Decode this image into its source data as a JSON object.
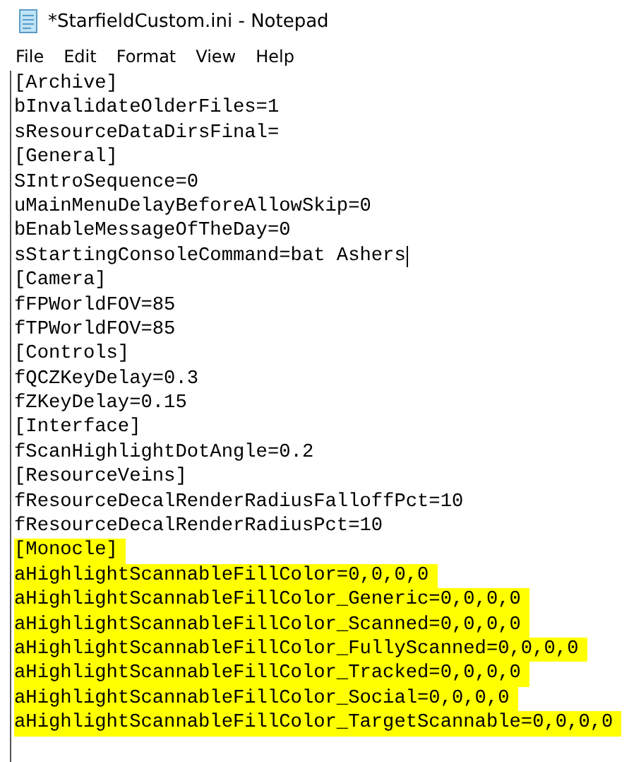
{
  "window": {
    "title": "*StarfieldCustom.ini - Notepad"
  },
  "menu": [
    "File",
    "Edit",
    "Format",
    "View",
    "Help"
  ],
  "lines": [
    {
      "text": "[Archive]",
      "highlighted": false,
      "cursor": false
    },
    {
      "text": "bInvalidateOlderFiles=1",
      "highlighted": false,
      "cursor": false
    },
    {
      "text": "sResourceDataDirsFinal=",
      "highlighted": false,
      "cursor": false
    },
    {
      "text": "[General]",
      "highlighted": false,
      "cursor": false
    },
    {
      "text": "SIntroSequence=0",
      "highlighted": false,
      "cursor": false
    },
    {
      "text": "uMainMenuDelayBeforeAllowSkip=0",
      "highlighted": false,
      "cursor": false
    },
    {
      "text": "bEnableMessageOfTheDay=0",
      "highlighted": false,
      "cursor": false
    },
    {
      "text": "sStartingConsoleCommand=bat Ashers",
      "highlighted": false,
      "cursor": true
    },
    {
      "text": "[Camera]",
      "highlighted": false,
      "cursor": false
    },
    {
      "text": "fFPWorldFOV=85",
      "highlighted": false,
      "cursor": false
    },
    {
      "text": "fTPWorldFOV=85",
      "highlighted": false,
      "cursor": false
    },
    {
      "text": "[Controls]",
      "highlighted": false,
      "cursor": false
    },
    {
      "text": "fQCZKeyDelay=0.3",
      "highlighted": false,
      "cursor": false
    },
    {
      "text": "fZKeyDelay=0.15",
      "highlighted": false,
      "cursor": false
    },
    {
      "text": "[Interface]",
      "highlighted": false,
      "cursor": false
    },
    {
      "text": "fScanHighlightDotAngle=0.2",
      "highlighted": false,
      "cursor": false
    },
    {
      "text": "[ResourceVeins]",
      "highlighted": false,
      "cursor": false
    },
    {
      "text": "fResourceDecalRenderRadiusFalloffPct=10",
      "highlighted": false,
      "cursor": false
    },
    {
      "text": "fResourceDecalRenderRadiusPct=10",
      "highlighted": false,
      "cursor": false
    },
    {
      "text": "[Monocle]",
      "highlighted": true,
      "cursor": false
    },
    {
      "text": "aHighlightScannableFillColor=0,0,0,0",
      "highlighted": true,
      "cursor": false
    },
    {
      "text": "aHighlightScannableFillColor_Generic=0,0,0,0",
      "highlighted": true,
      "cursor": false
    },
    {
      "text": "aHighlightScannableFillColor_Scanned=0,0,0,0",
      "highlighted": true,
      "cursor": false
    },
    {
      "text": "aHighlightScannableFillColor_FullyScanned=0,0,0,0",
      "highlighted": true,
      "cursor": false
    },
    {
      "text": "aHighlightScannableFillColor_Tracked=0,0,0,0",
      "highlighted": true,
      "cursor": false
    },
    {
      "text": "aHighlightScannableFillColor_Social=0,0,0,0",
      "highlighted": true,
      "cursor": false
    },
    {
      "text": "aHighlightScannableFillColor_TargetScannable=0,0,0,0",
      "highlighted": true,
      "cursor": false
    }
  ]
}
